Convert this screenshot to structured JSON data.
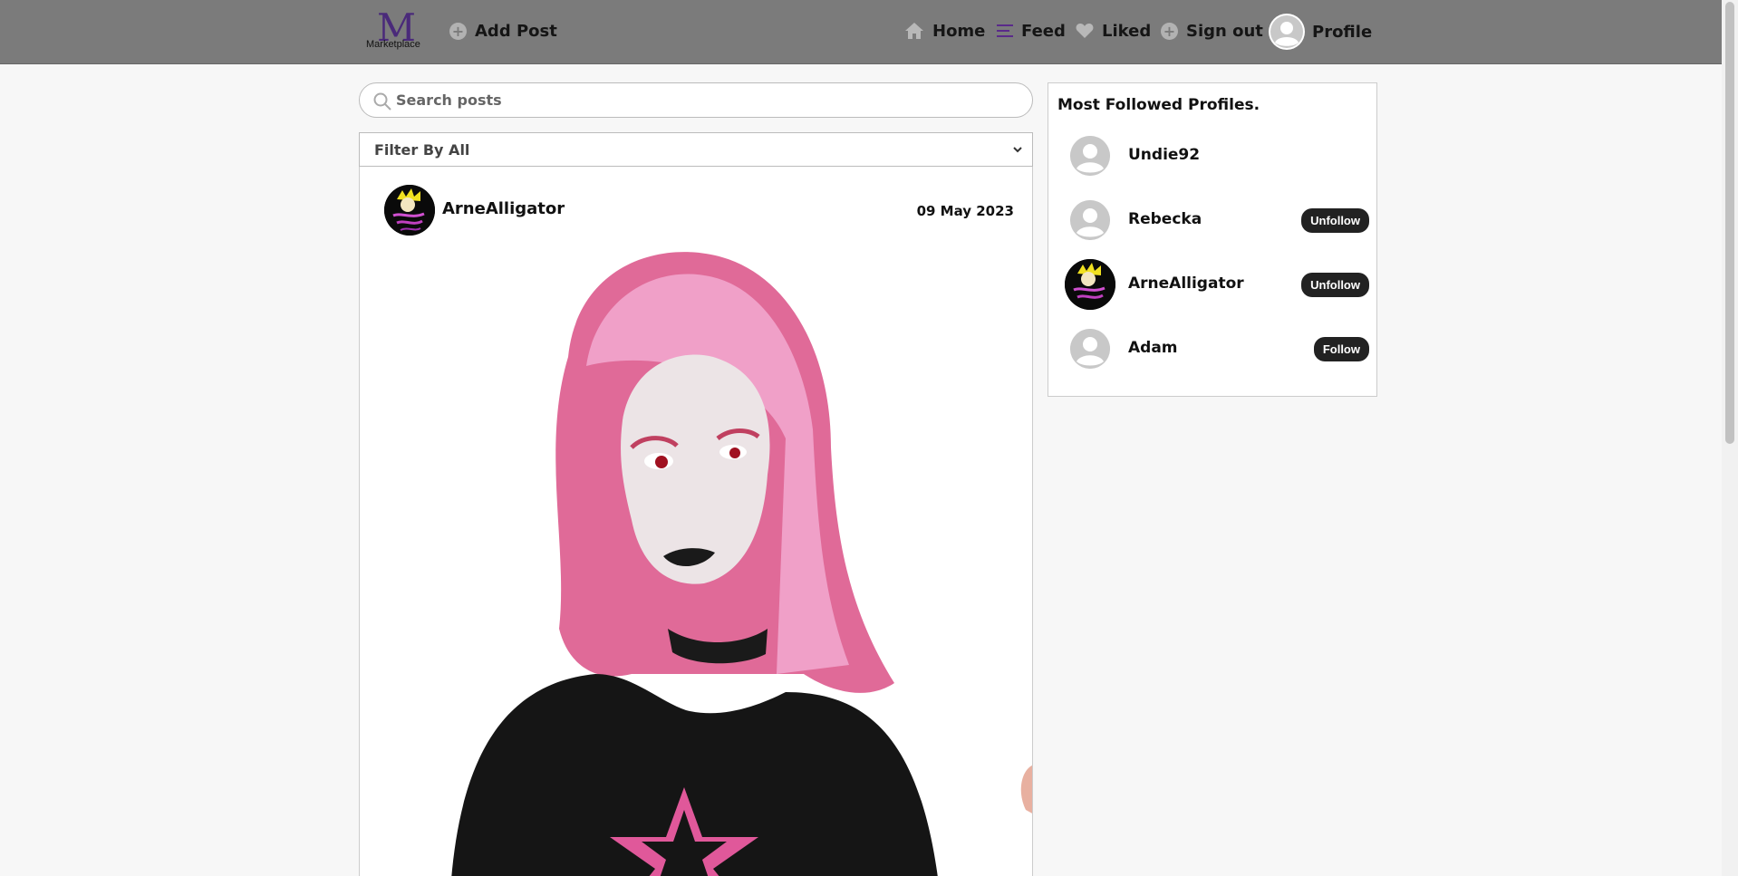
{
  "navbar": {
    "logo_text": "Marketplace",
    "add_post": "Add Post",
    "home": "Home",
    "feed": "Feed",
    "liked": "Liked",
    "sign_out": "Sign out",
    "profile": "Profile"
  },
  "search": {
    "placeholder": "Search posts"
  },
  "filter": {
    "label": "Filter By All"
  },
  "post": {
    "username": "ArneAlligator",
    "date": "09 May 2023"
  },
  "sidebar": {
    "title": "Most Followed Profiles.",
    "profiles": [
      {
        "name": "Undie92",
        "action": ""
      },
      {
        "name": "Rebecka",
        "action": "Unfollow"
      },
      {
        "name": "ArneAlligator",
        "action": "Unfollow"
      },
      {
        "name": "Adam",
        "action": "Follow"
      }
    ]
  },
  "colors": {
    "navbar_bg": "#7b7b7b",
    "page_bg": "#f7f7f7",
    "button_bg": "#222222",
    "logo_accent": "#4a2a7a"
  },
  "icons": [
    "plus-circle-icon",
    "home-icon",
    "feed-icon",
    "heart-icon",
    "user-icon",
    "search-icon",
    "chevron-down-icon"
  ]
}
